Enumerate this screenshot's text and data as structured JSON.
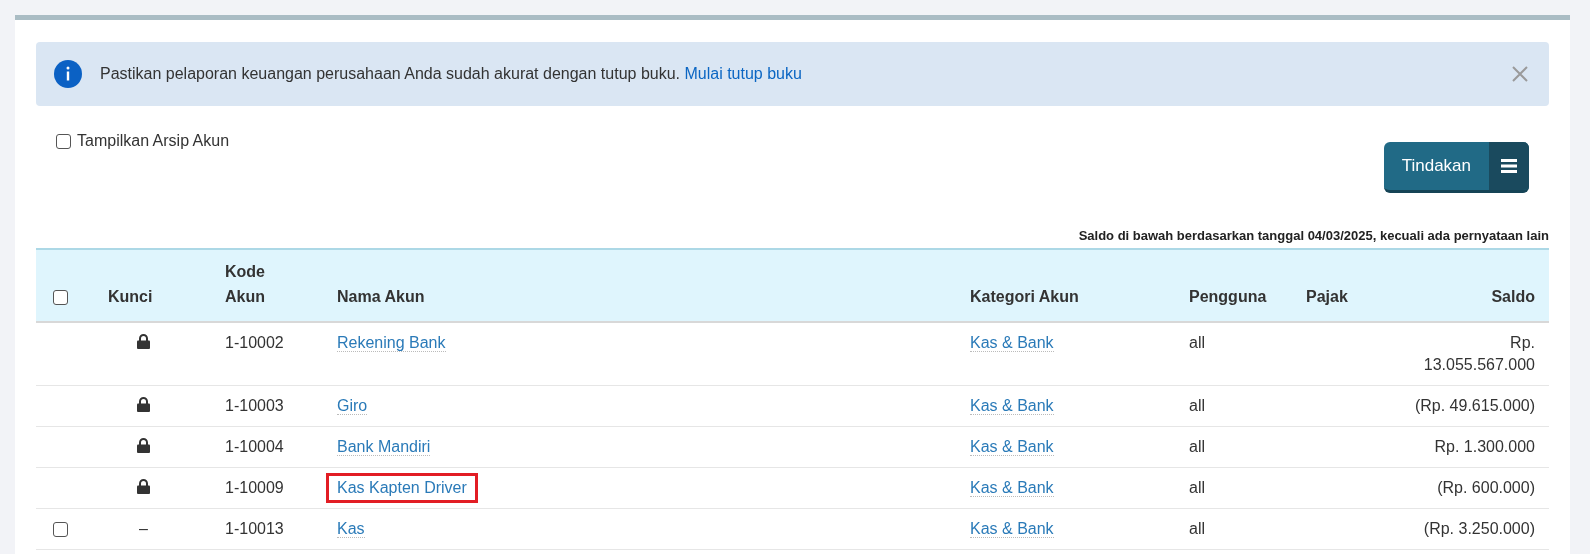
{
  "alert": {
    "message": "Pastikan pelaporan keuangan perusahaan Anda sudah akurat dengan tutup buku.",
    "link": "Mulai tutup buku"
  },
  "show_archived": {
    "label": "Tampilkan Arsip Akun",
    "checked": false
  },
  "actions_button": {
    "label": "Tindakan"
  },
  "balance_note": "Saldo di bawah berdasarkan tanggal 04/03/2025, kecuali ada pernyataan lain",
  "table": {
    "select_all_checked": false,
    "columns": [
      "Kunci",
      "Kode Akun",
      "Nama Akun",
      "Kategori Akun",
      "Pengguna",
      "Pajak",
      "Saldo"
    ],
    "rows": [
      {
        "locked": true,
        "code": "1-10002",
        "name": "Rekening Bank",
        "highlighted": false,
        "category": "Kas & Bank",
        "user": "all",
        "balance": "Rp. 13.055.567.000"
      },
      {
        "locked": true,
        "code": "1-10003",
        "name": "Giro",
        "highlighted": false,
        "category": "Kas & Bank",
        "user": "all",
        "balance": "(Rp. 49.615.000)"
      },
      {
        "locked": true,
        "code": "1-10004",
        "name": "Bank Mandiri",
        "highlighted": false,
        "category": "Kas & Bank",
        "user": "all",
        "balance": "Rp. 1.300.000"
      },
      {
        "locked": true,
        "code": "1-10009",
        "name": "Kas Kapten Driver",
        "highlighted": true,
        "category": "Kas & Bank",
        "user": "all",
        "balance": "(Rp. 600.000)"
      },
      {
        "locked": false,
        "checked": false,
        "lock_text": "–",
        "code": "1-10013",
        "name": "Kas",
        "highlighted": false,
        "category": "Kas & Bank",
        "user": "all",
        "balance": "(Rp. 3.250.000)"
      }
    ]
  }
}
